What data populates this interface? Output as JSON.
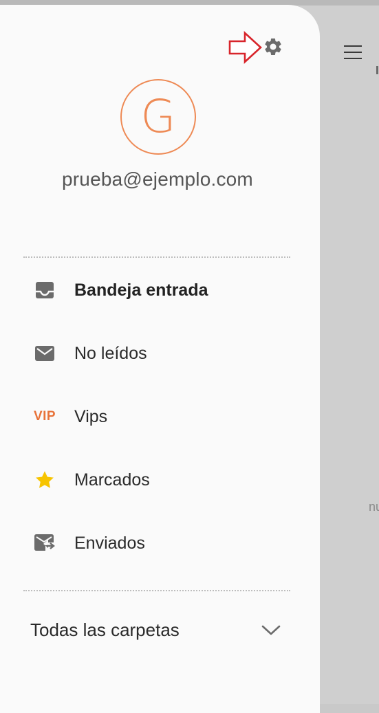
{
  "background": {
    "partial_text": "nu"
  },
  "drawer": {
    "avatar_letter": "G",
    "email": "prueba@ejemplo.com",
    "menu": [
      {
        "label": "Bandeja entrada",
        "icon": "inbox-icon",
        "bold": true
      },
      {
        "label": "No leídos",
        "icon": "envelope-icon",
        "bold": false
      },
      {
        "label": "Vips",
        "icon": "vip-icon",
        "icon_text": "VIP",
        "bold": false
      },
      {
        "label": "Marcados",
        "icon": "star-icon",
        "bold": false
      },
      {
        "label": "Enviados",
        "icon": "sent-mail-icon",
        "bold": false
      }
    ],
    "all_folders_label": "Todas las carpetas"
  },
  "colors": {
    "accent": "#ee8a55",
    "vip": "#e8733a",
    "star": "#f7c400",
    "annotation_arrow": "#d8252b",
    "icon_gray": "#6b6b6b"
  }
}
